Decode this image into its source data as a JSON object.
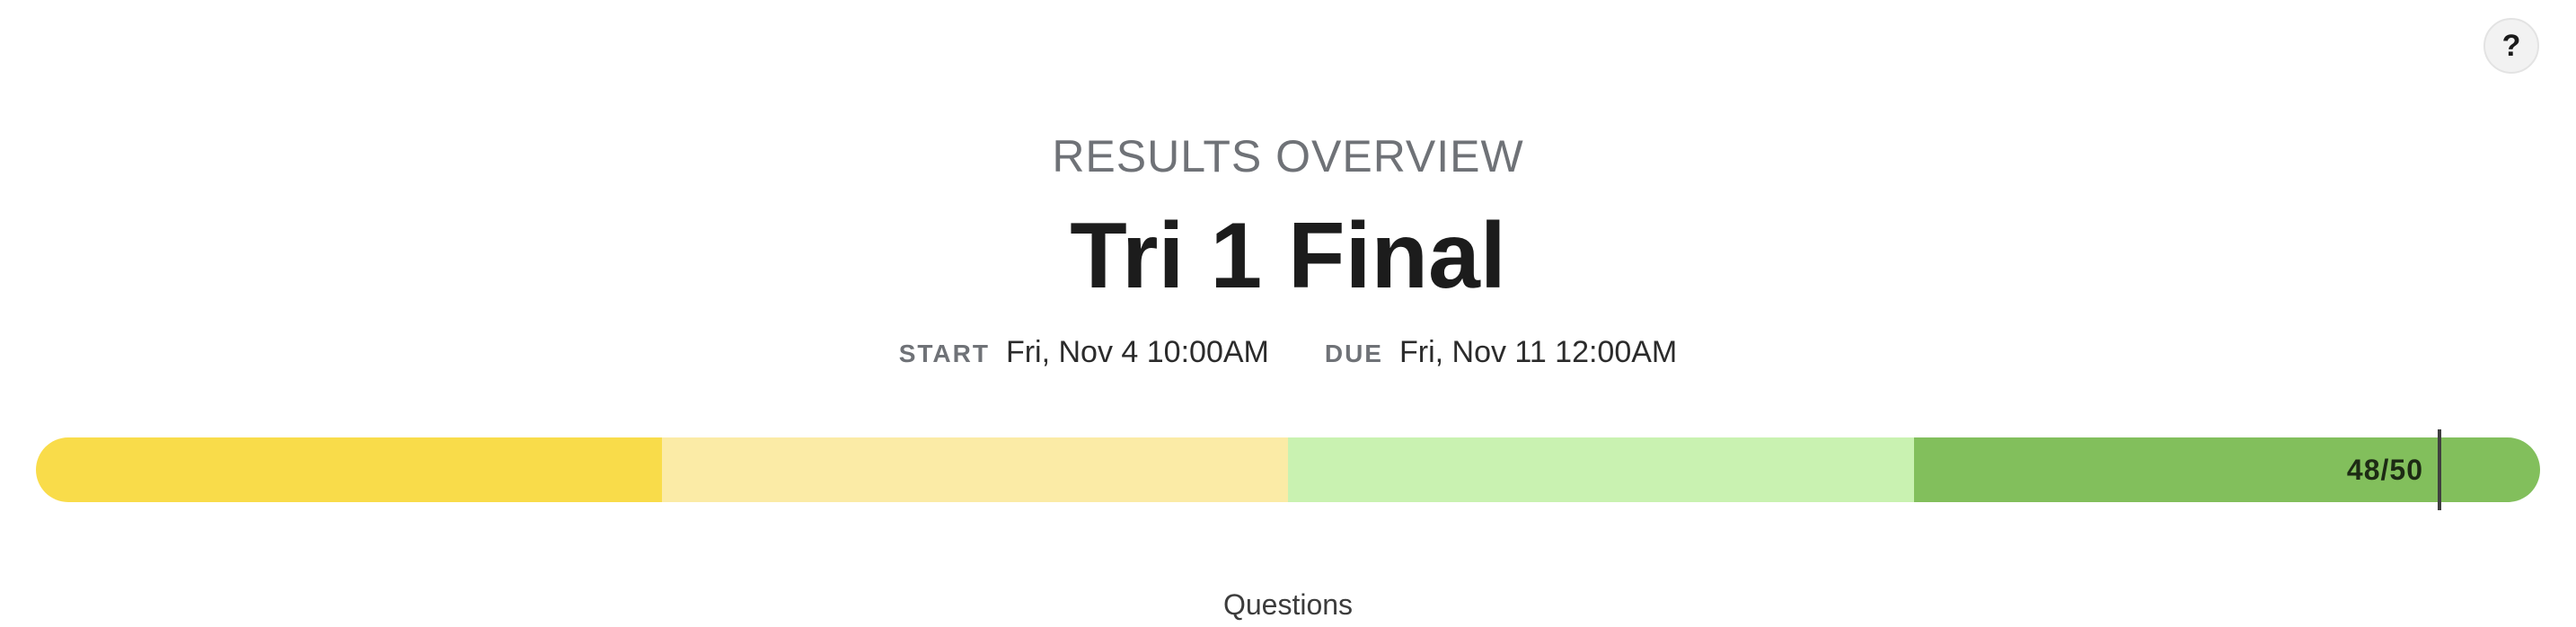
{
  "help": {
    "icon": "help-icon",
    "label": "?"
  },
  "header": {
    "overline": "RESULTS OVERVIEW",
    "title": "Tri 1 Final"
  },
  "dates": {
    "start_label": "START",
    "start_value": "Fri, Nov 4 10:00AM",
    "due_label": "DUE",
    "due_value": "Fri, Nov 11 12:00AM"
  },
  "score": {
    "text": "48/50",
    "earned": 48,
    "possible": 50,
    "fraction": 0.96,
    "band_colors": [
      "#f9dc4a",
      "#fbeba6",
      "#c9f2b1",
      "#82bf5c"
    ],
    "marker_color": "#404040"
  },
  "sections": {
    "questions_heading": "Questions"
  }
}
